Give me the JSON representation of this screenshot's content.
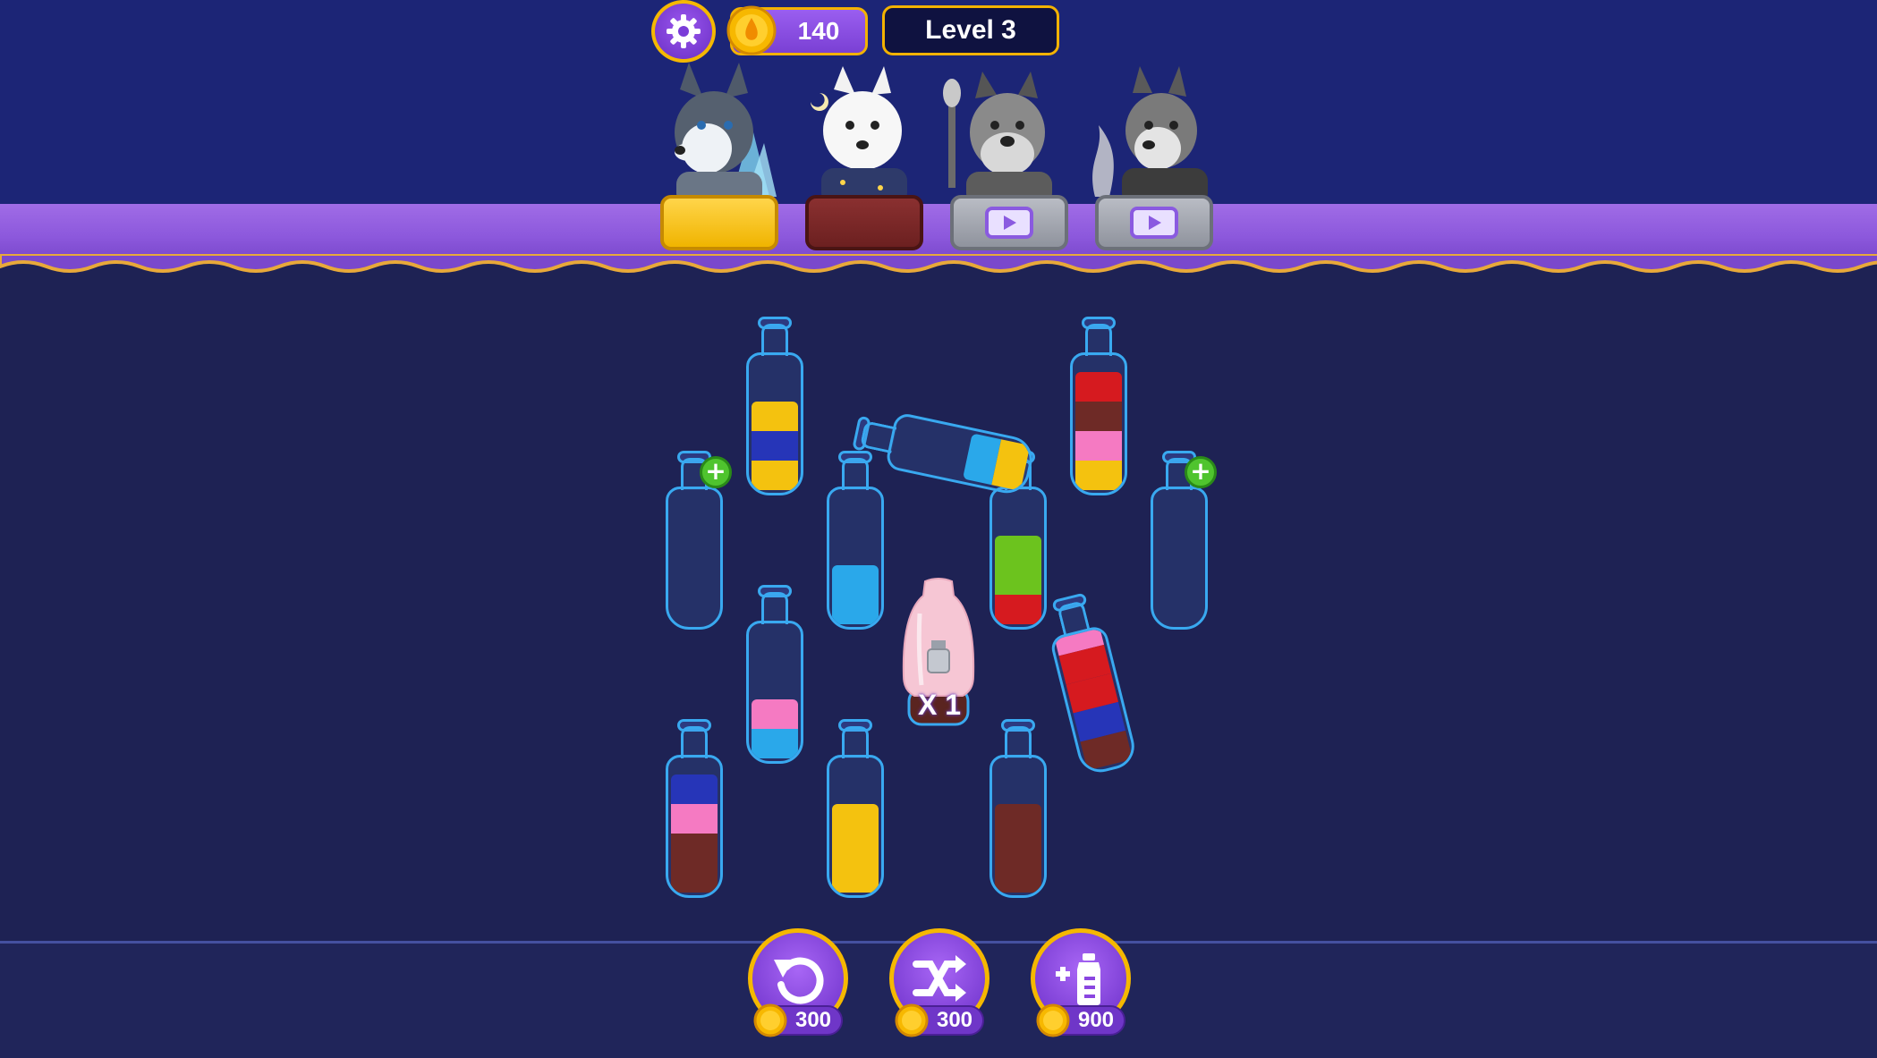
{
  "hud": {
    "coins": "140",
    "level": "Level 3",
    "settings_icon": "gear-icon",
    "coin_icon": "coin-icon"
  },
  "characters": [
    {
      "name_icon": "husky-icon",
      "pad": "yellow",
      "state": "selected"
    },
    {
      "name_icon": "samoyed-icon",
      "pad": "red",
      "state": "unlocked"
    },
    {
      "name_icon": "schnauzer-icon",
      "pad": "gray",
      "state": "locked-video"
    },
    {
      "name_icon": "shiba-icon",
      "pad": "gray",
      "state": "locked-video"
    }
  ],
  "colors": {
    "yellow": "#f4c20f",
    "blue": "#2635b8",
    "red": "#d61a1f",
    "brown": "#6e2a26",
    "pink": "#f57ac2",
    "lightblue": "#2aa8ea",
    "green": "#6cc31e",
    "accent_gold": "#f5b800",
    "button_purple": "#8a46e0"
  },
  "bottles": [
    {
      "id": "b1",
      "layers": [
        "yellow",
        "blue",
        "yellow"
      ]
    },
    {
      "id": "b2",
      "layers": [
        "yellow",
        "pink",
        "brown",
        "red"
      ]
    },
    {
      "id": "b3",
      "layers": [],
      "badge": "plus"
    },
    {
      "id": "b4",
      "layers": [
        "lightblue",
        "lightblue"
      ]
    },
    {
      "id": "b5",
      "layers": [
        "red",
        "green",
        "green"
      ]
    },
    {
      "id": "b6",
      "layers": [],
      "badge": "plus"
    },
    {
      "id": "b7",
      "layers": [
        "lightblue",
        "pink"
      ]
    },
    {
      "id": "b8",
      "layers": [
        "brown",
        "brown",
        "pink",
        "blue"
      ]
    },
    {
      "id": "b9",
      "layers": [
        "yellow",
        "yellow",
        "yellow"
      ]
    },
    {
      "id": "b10",
      "layers": [
        "brown",
        "brown",
        "brown"
      ]
    },
    {
      "id": "b11",
      "state": "pouring",
      "layers": [
        "yellow",
        "lightblue"
      ]
    },
    {
      "id": "b12",
      "state": "tilted",
      "layers": [
        "brown",
        "blue",
        "red",
        "red",
        "pink"
      ]
    }
  ],
  "hidden_bottle": {
    "label": "X 1",
    "icon": "bottle-icon"
  },
  "powerups": [
    {
      "id": "undo",
      "icon": "undo-icon",
      "price": "300"
    },
    {
      "id": "shuffle",
      "icon": "shuffle-icon",
      "price": "300"
    },
    {
      "id": "add_bottle",
      "icon": "add-bottle-icon",
      "price": "900"
    }
  ]
}
